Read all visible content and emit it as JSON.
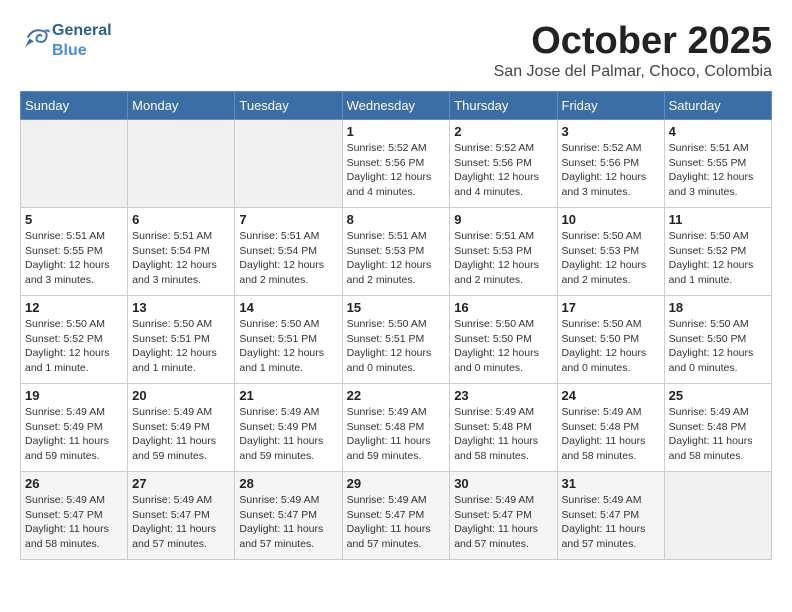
{
  "header": {
    "logo_general": "General",
    "logo_blue": "Blue",
    "month_title": "October 2025",
    "subtitle": "San Jose del Palmar, Choco, Colombia"
  },
  "weekdays": [
    "Sunday",
    "Monday",
    "Tuesday",
    "Wednesday",
    "Thursday",
    "Friday",
    "Saturday"
  ],
  "weeks": [
    [
      {
        "day": "",
        "info": ""
      },
      {
        "day": "",
        "info": ""
      },
      {
        "day": "",
        "info": ""
      },
      {
        "day": "1",
        "info": "Sunrise: 5:52 AM\nSunset: 5:56 PM\nDaylight: 12 hours\nand 4 minutes."
      },
      {
        "day": "2",
        "info": "Sunrise: 5:52 AM\nSunset: 5:56 PM\nDaylight: 12 hours\nand 4 minutes."
      },
      {
        "day": "3",
        "info": "Sunrise: 5:52 AM\nSunset: 5:56 PM\nDaylight: 12 hours\nand 3 minutes."
      },
      {
        "day": "4",
        "info": "Sunrise: 5:51 AM\nSunset: 5:55 PM\nDaylight: 12 hours\nand 3 minutes."
      }
    ],
    [
      {
        "day": "5",
        "info": "Sunrise: 5:51 AM\nSunset: 5:55 PM\nDaylight: 12 hours\nand 3 minutes."
      },
      {
        "day": "6",
        "info": "Sunrise: 5:51 AM\nSunset: 5:54 PM\nDaylight: 12 hours\nand 3 minutes."
      },
      {
        "day": "7",
        "info": "Sunrise: 5:51 AM\nSunset: 5:54 PM\nDaylight: 12 hours\nand 2 minutes."
      },
      {
        "day": "8",
        "info": "Sunrise: 5:51 AM\nSunset: 5:53 PM\nDaylight: 12 hours\nand 2 minutes."
      },
      {
        "day": "9",
        "info": "Sunrise: 5:51 AM\nSunset: 5:53 PM\nDaylight: 12 hours\nand 2 minutes."
      },
      {
        "day": "10",
        "info": "Sunrise: 5:50 AM\nSunset: 5:53 PM\nDaylight: 12 hours\nand 2 minutes."
      },
      {
        "day": "11",
        "info": "Sunrise: 5:50 AM\nSunset: 5:52 PM\nDaylight: 12 hours\nand 1 minute."
      }
    ],
    [
      {
        "day": "12",
        "info": "Sunrise: 5:50 AM\nSunset: 5:52 PM\nDaylight: 12 hours\nand 1 minute."
      },
      {
        "day": "13",
        "info": "Sunrise: 5:50 AM\nSunset: 5:51 PM\nDaylight: 12 hours\nand 1 minute."
      },
      {
        "day": "14",
        "info": "Sunrise: 5:50 AM\nSunset: 5:51 PM\nDaylight: 12 hours\nand 1 minute."
      },
      {
        "day": "15",
        "info": "Sunrise: 5:50 AM\nSunset: 5:51 PM\nDaylight: 12 hours\nand 0 minutes."
      },
      {
        "day": "16",
        "info": "Sunrise: 5:50 AM\nSunset: 5:50 PM\nDaylight: 12 hours\nand 0 minutes."
      },
      {
        "day": "17",
        "info": "Sunrise: 5:50 AM\nSunset: 5:50 PM\nDaylight: 12 hours\nand 0 minutes."
      },
      {
        "day": "18",
        "info": "Sunrise: 5:50 AM\nSunset: 5:50 PM\nDaylight: 12 hours\nand 0 minutes."
      }
    ],
    [
      {
        "day": "19",
        "info": "Sunrise: 5:49 AM\nSunset: 5:49 PM\nDaylight: 11 hours\nand 59 minutes."
      },
      {
        "day": "20",
        "info": "Sunrise: 5:49 AM\nSunset: 5:49 PM\nDaylight: 11 hours\nand 59 minutes."
      },
      {
        "day": "21",
        "info": "Sunrise: 5:49 AM\nSunset: 5:49 PM\nDaylight: 11 hours\nand 59 minutes."
      },
      {
        "day": "22",
        "info": "Sunrise: 5:49 AM\nSunset: 5:48 PM\nDaylight: 11 hours\nand 59 minutes."
      },
      {
        "day": "23",
        "info": "Sunrise: 5:49 AM\nSunset: 5:48 PM\nDaylight: 11 hours\nand 58 minutes."
      },
      {
        "day": "24",
        "info": "Sunrise: 5:49 AM\nSunset: 5:48 PM\nDaylight: 11 hours\nand 58 minutes."
      },
      {
        "day": "25",
        "info": "Sunrise: 5:49 AM\nSunset: 5:48 PM\nDaylight: 11 hours\nand 58 minutes."
      }
    ],
    [
      {
        "day": "26",
        "info": "Sunrise: 5:49 AM\nSunset: 5:47 PM\nDaylight: 11 hours\nand 58 minutes."
      },
      {
        "day": "27",
        "info": "Sunrise: 5:49 AM\nSunset: 5:47 PM\nDaylight: 11 hours\nand 57 minutes."
      },
      {
        "day": "28",
        "info": "Sunrise: 5:49 AM\nSunset: 5:47 PM\nDaylight: 11 hours\nand 57 minutes."
      },
      {
        "day": "29",
        "info": "Sunrise: 5:49 AM\nSunset: 5:47 PM\nDaylight: 11 hours\nand 57 minutes."
      },
      {
        "day": "30",
        "info": "Sunrise: 5:49 AM\nSunset: 5:47 PM\nDaylight: 11 hours\nand 57 minutes."
      },
      {
        "day": "31",
        "info": "Sunrise: 5:49 AM\nSunset: 5:47 PM\nDaylight: 11 hours\nand 57 minutes."
      },
      {
        "day": "",
        "info": ""
      }
    ]
  ]
}
